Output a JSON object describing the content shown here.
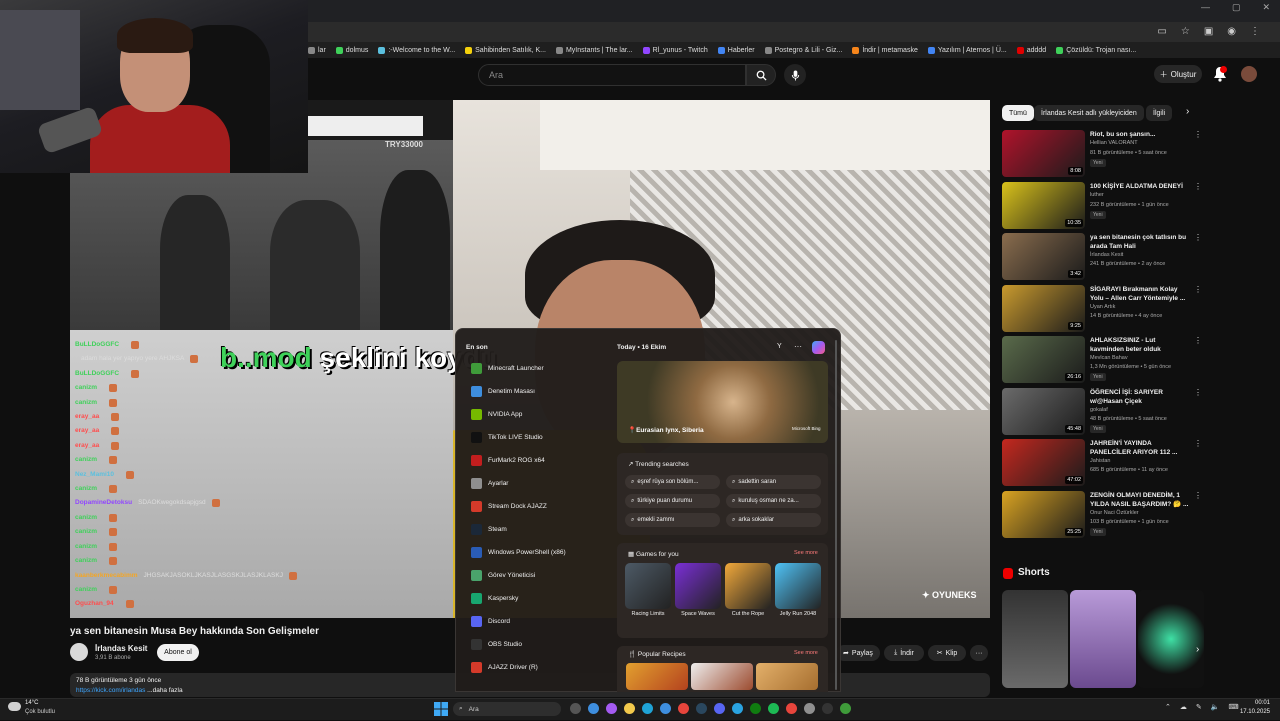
{
  "browser": {
    "window_controls": [
      "—",
      "▢",
      "✕"
    ],
    "bookmarks": [
      {
        "label": "lar",
        "color": "#888888"
      },
      {
        "label": "dolmus",
        "color": "#3fd15a"
      },
      {
        "label": ":-Welcome to the W...",
        "color": "#5bc0de"
      },
      {
        "label": "Sahibinden Satılık, K...",
        "color": "#f5d10c"
      },
      {
        "label": "MyInstants | The lar...",
        "color": "#888888"
      },
      {
        "label": "Rl_yunus - Twitch",
        "color": "#9146ff"
      },
      {
        "label": "Haberler",
        "color": "#4285f4"
      },
      {
        "label": "Postegro & Lili - Giz...",
        "color": "#888888"
      },
      {
        "label": "İndir | metamaske",
        "color": "#f6851b"
      },
      {
        "label": "Yazılım | Aternos | Ü...",
        "color": "#4285f4"
      },
      {
        "label": "adddd",
        "color": "#e00000"
      },
      {
        "label": "Çözüldü: Trojan nası...",
        "color": "#3fd15a"
      }
    ]
  },
  "youtube": {
    "search_placeholder": "Ara",
    "create_label": "Oluştur",
    "notification_count": ""
  },
  "video": {
    "overlay_code": "TRY33000",
    "subtitle_highlight": "b..mod",
    "subtitle_rest": "şeklini koydu",
    "watermark": "OYUNEKS",
    "chat": [
      {
        "user": "BuLLDoGGFC",
        "msg": "",
        "color": "#3fd15a"
      },
      {
        "user": "",
        "msg": "adam hala yer yapıyo yere AHJKSA",
        "color": "#bbbbbb"
      },
      {
        "user": "BuLLDoGGFC",
        "msg": "",
        "color": "#3fd15a"
      },
      {
        "user": "canizm",
        "msg": "",
        "color": "#3fd15a"
      },
      {
        "user": "canizm",
        "msg": "",
        "color": "#3fd15a"
      },
      {
        "user": "eray_aa",
        "msg": "",
        "color": "#ff4d4d"
      },
      {
        "user": "eray_aa",
        "msg": "",
        "color": "#ff4d4d"
      },
      {
        "user": "eray_aa",
        "msg": "",
        "color": "#ff4d4d"
      },
      {
        "user": "canizm",
        "msg": "",
        "color": "#3fd15a"
      },
      {
        "user": "Nez_Mami10",
        "msg": "",
        "color": "#5bc0de"
      },
      {
        "user": "canizm",
        "msg": "",
        "color": "#3fd15a"
      },
      {
        "user": "DopamineDetoksu",
        "msg": "SDAOKwegokdsapjgsd",
        "color": "#9146ff"
      },
      {
        "user": "canizm",
        "msg": "",
        "color": "#3fd15a"
      },
      {
        "user": "canizm",
        "msg": "",
        "color": "#3fd15a"
      },
      {
        "user": "canizm",
        "msg": "",
        "color": "#3fd15a"
      },
      {
        "user": "canizm",
        "msg": "",
        "color": "#3fd15a"
      },
      {
        "user": "kaanberkmecabimm",
        "msg": "JHGSAKJASOKLJKASJLASGSKJLASJKLASKJ",
        "color": "#f5a623"
      },
      {
        "user": "canizm",
        "msg": "",
        "color": "#3fd15a"
      },
      {
        "user": "Oguzhan_94",
        "msg": "",
        "color": "#ff4d4d"
      }
    ],
    "title": "ya sen bitanesin Musa Bey hakkında Son Gelişmeler",
    "channel": "İrlandas Kesit",
    "subscribers": "3,91 B abone",
    "subscribe_label": "Abone ol",
    "stats": "78 B görüntüleme  3 gün önce",
    "link_text": "https://kick.com/irlandas",
    "more_text": " ...daha fazla",
    "actions": {
      "share": "Paylaş",
      "download": "İndir",
      "clip": "Klip",
      "more": "···"
    }
  },
  "sidebar": {
    "chips": [
      "Tümü",
      "İrlandas Kesit adlı yükleyiciden",
      "İlgili"
    ],
    "recommendations": [
      {
        "title": "Riot, bu son şansın...",
        "channel": "Hellian VALORANT",
        "meta": "81 B görüntüleme • 5 saat önce",
        "badge": "Yeni",
        "duration": "8:08",
        "color": "#b0132b"
      },
      {
        "title": "100 KİŞİYE ALDATMA DENEYİ",
        "channel": "luther",
        "meta": "232 B görüntüleme • 1 gün önce",
        "badge": "Yeni",
        "duration": "10:35",
        "color": "#d9c21b"
      },
      {
        "title": "ya sen bitanesin çok tatlısın bu arada Tam Hali",
        "channel": "İrlandas Kesit",
        "meta": "241 B görüntüleme • 2 ay önce",
        "badge": "",
        "duration": "3:42",
        "color": "#8a6d4e"
      },
      {
        "title": "SİGARAYI Bırakmanın Kolay Yolu – Allen Carr Yöntemiyle ...",
        "channel": "Uyan Artık",
        "meta": "14 B görüntüleme • 4 ay önce",
        "badge": "",
        "duration": "9:25",
        "color": "#c99a2e"
      },
      {
        "title": "AHLAKSIZSINIZ - Lut kavminden beter olduk",
        "channel": "Mevlcan Bahav",
        "meta": "1,3 Mn görüntüleme • 5 gün önce",
        "badge": "Yeni",
        "duration": "26:16",
        "color": "#5a6b4b"
      },
      {
        "title": "ÖĞRENCİ İŞİ: SARIYER w/@Hasan Çiçek",
        "channel": "gokalaf",
        "meta": "48 B görüntüleme • 5 saat önce",
        "badge": "Yeni",
        "duration": "45:48",
        "color": "#6b6b6b"
      },
      {
        "title": "JAHREİN'İ YAYINDA PANELCİLER ARIYOR 112 ...",
        "channel": "Jahistan",
        "meta": "685 B görüntüleme • 11 ay önce",
        "badge": "",
        "duration": "47:02",
        "color": "#c4281f"
      },
      {
        "title": "ZENGİN OLMAYI DENEDİM, 1 YILDA NASIL BAŞARDIM? 🤔 ...",
        "channel": "Onur Naci Öztürkler",
        "meta": "103 B görüntüleme • 1 gün önce",
        "badge": "Yeni",
        "duration": "25:25",
        "color": "#d9a322"
      }
    ],
    "shorts_title": "Shorts"
  },
  "startmenu": {
    "recent_label": "En son",
    "apps": [
      {
        "label": "Minecraft Launcher",
        "color": "#3f9b3a"
      },
      {
        "label": "Denetim Masası",
        "color": "#3e8ede"
      },
      {
        "label": "NVIDIA App",
        "color": "#76b900"
      },
      {
        "label": "TikTok LIVE Studio",
        "color": "#111111"
      },
      {
        "label": "FurMark2 ROG x64",
        "color": "#c21e1e"
      },
      {
        "label": "Ayarlar",
        "color": "#8f8f8f"
      },
      {
        "label": "Stream Dock AJAZZ",
        "color": "#d43a2a"
      },
      {
        "label": "Steam",
        "color": "#1b2838"
      },
      {
        "label": "Windows PowerShell (x86)",
        "color": "#2a5cb5"
      },
      {
        "label": "Görev Yöneticisi",
        "color": "#4aa36b"
      },
      {
        "label": "Kaspersky",
        "color": "#18a66f"
      },
      {
        "label": "Discord",
        "color": "#5865f2"
      },
      {
        "label": "OBS Studio",
        "color": "#333333"
      },
      {
        "label": "AJAZZ Driver  (R)",
        "color": "#d43a2a"
      }
    ],
    "today": "Today  •  16 Ekim",
    "y": "Y",
    "more": "···",
    "feature_caption": "Eurasian lynx, Siberia",
    "feature_source": "Microsoft Bing",
    "trending_label": "Trending searches",
    "trends": [
      "eşref rüya son bölüm...",
      "sadettin saran",
      "türkiye puan durumu",
      "kuruluş osman ne za...",
      "emekli zammı",
      "arka sokaklar"
    ],
    "games_label": "Games for you",
    "see_more": "See more",
    "games": [
      {
        "label": "Racing Limits",
        "color": "#4d5a66"
      },
      {
        "label": "Space Waves",
        "color": "#7a2fd6"
      },
      {
        "label": "Cut the Rope",
        "color": "#f2a93b"
      },
      {
        "label": "Jelly Run 2048",
        "color": "#4fc3f7"
      }
    ],
    "recipes_label": "Popular Recipes"
  },
  "taskbar": {
    "temperature": "14°C",
    "weather": "Çok bulutlu",
    "search_placeholder": "Ara",
    "time": "00:01",
    "date": "17.10.2025"
  }
}
